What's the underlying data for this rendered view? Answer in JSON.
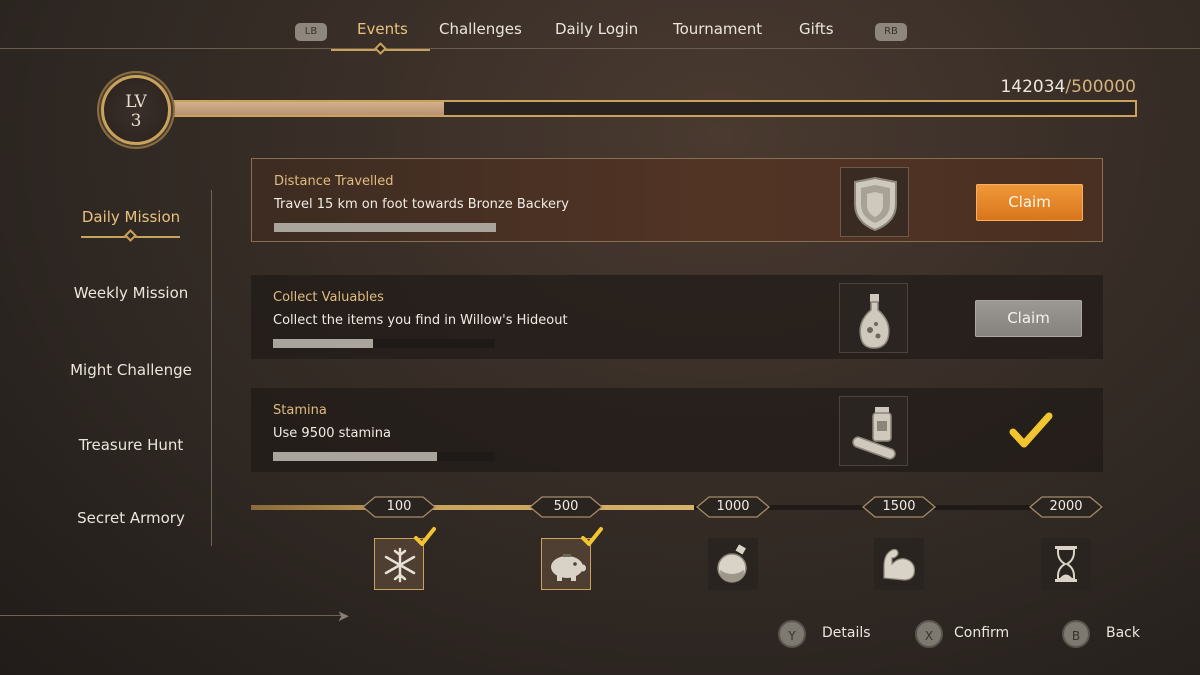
{
  "tabs": {
    "left_bumper": "LB",
    "right_bumper": "RB",
    "items": [
      {
        "label": "Events",
        "active": true
      },
      {
        "label": "Challenges",
        "active": false
      },
      {
        "label": "Daily Login",
        "active": false
      },
      {
        "label": "Tournament",
        "active": false
      },
      {
        "label": "Gifts",
        "active": false
      }
    ]
  },
  "level": {
    "lv_label": "LV",
    "lv_value": "3",
    "xp_current": "142034",
    "xp_separator": "/",
    "xp_max": "500000",
    "xp_fraction": 0.284
  },
  "sidenav": {
    "items": [
      {
        "label": "Daily Mission",
        "active": true
      },
      {
        "label": "Weekly Mission",
        "active": false
      },
      {
        "label": "Might Challenge",
        "active": false
      },
      {
        "label": "Treasure Hunt",
        "active": false
      },
      {
        "label": "Secret Armory",
        "active": false
      }
    ]
  },
  "missions": [
    {
      "title": "Distance Travelled",
      "desc": "Travel 15 km on foot towards Bronze Backery",
      "progress": 1.0,
      "icon": "shield-icon",
      "status": "claim_active",
      "claim_label": "Claim"
    },
    {
      "title": "Collect Valuables",
      "desc": "Collect the items you find in Willow's Hideout",
      "progress": 0.45,
      "icon": "potion-flask-icon",
      "status": "claim_inactive",
      "claim_label": "Claim"
    },
    {
      "title": "Stamina",
      "desc": "Use 9500 stamina",
      "progress": 0.74,
      "icon": "scroll-bottle-icon",
      "status": "completed"
    }
  ],
  "rewards": {
    "progress_fraction": 0.52,
    "milestones": [
      {
        "value": "100",
        "icon": "snowflake-icon",
        "claimed": true
      },
      {
        "value": "500",
        "icon": "piggy-bank-icon",
        "claimed": true
      },
      {
        "value": "1000",
        "icon": "bomb-flask-icon",
        "claimed": false
      },
      {
        "value": "1500",
        "icon": "flexed-arm-icon",
        "claimed": false
      },
      {
        "value": "2000",
        "icon": "hourglass-icon",
        "claimed": false
      }
    ]
  },
  "hints": [
    {
      "button": "Y",
      "label": "Details"
    },
    {
      "button": "X",
      "label": "Confirm"
    },
    {
      "button": "B",
      "label": "Back"
    }
  ],
  "colors": {
    "accent_gold": "#c9a25c",
    "claim_orange": "#e8852a",
    "claim_gray": "#918d88",
    "check_yellow": "#f2c530"
  }
}
